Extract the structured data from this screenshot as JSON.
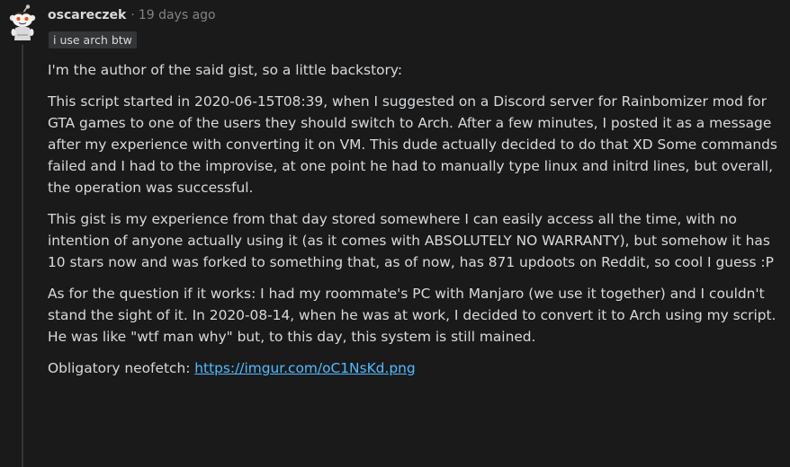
{
  "comment": {
    "author": "oscareczek",
    "separator": "·",
    "timestamp": "19 days ago",
    "flair": "i use arch btw",
    "paragraphs": [
      "I'm the author of the said gist, so a little backstory:",
      "This script started in 2020-06-15T08:39, when I suggested on a Discord server for Rainbomizer mod for GTA games to one of the users they should switch to Arch. After a few minutes, I posted it as a message after my experience with converting it on VM. This dude actually decided to do that XD Some commands failed and I had to the improvise, at one point he had to manually type linux and initrd lines, but overall, the operation was successful.",
      "This gist is my experience from that day stored somewhere I can easily access all the time, with no intention of anyone actually using it (as it comes with ABSOLUTELY NO WARRANTY), but somehow it has 10 stars now and was forked to something that, as of now, has 871 updoots on Reddit, so cool I guess :P",
      "As for the question if it works: I had my roommate's PC with Manjaro (we use it together) and I couldn't stand the sight of it. In 2020-08-14, when he was at work, I decided to convert it to Arch using my script. He was like \"wtf man why\" but, to this day, this system is still mained."
    ],
    "neofetch_label": "Obligatory neofetch: ",
    "neofetch_link": "https://imgur.com/oC1NsKd.png",
    "avatar_icon": "snoo-avatar-icon"
  },
  "colors": {
    "background": "#1a1a1b",
    "text": "#d7dadc",
    "meta": "#818384",
    "link": "#4fbcff",
    "flair_bg": "#343536"
  }
}
